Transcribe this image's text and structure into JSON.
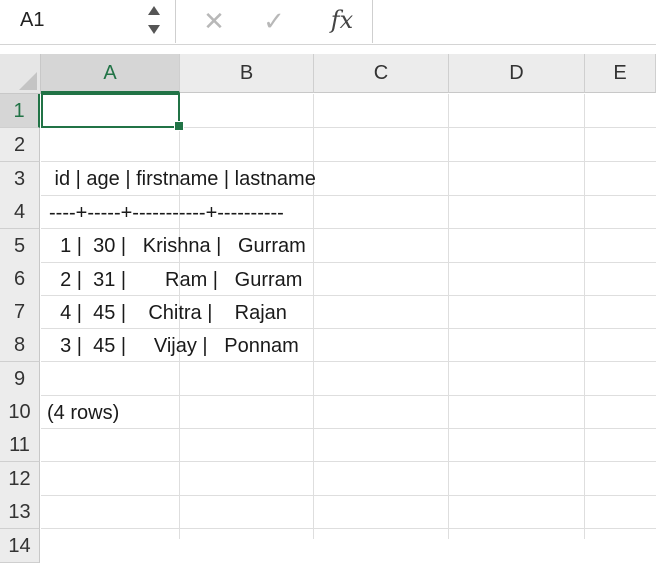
{
  "formula_bar": {
    "name_box": "A1",
    "cancel_icon": "✕",
    "confirm_icon": "✓",
    "fx_label": "fx",
    "formula": ""
  },
  "colors": {
    "accent": "#217346",
    "header_bg": "#ececec",
    "gridline": "#dedede"
  },
  "columns": [
    "A",
    "B",
    "C",
    "D",
    "E"
  ],
  "rows": [
    "1",
    "2",
    "3",
    "4",
    "5",
    "6",
    "7",
    "8",
    "9",
    "10",
    "11",
    "12",
    "13",
    "14"
  ],
  "cells": {
    "A1": "",
    "A2": " id | age | firstname | lastname",
    "A3": "----+-----+-----------+----------",
    "A4": "  1 |  30 |   Krishna |   Gurram",
    "A5": "  2 |  31 |       Ram |   Gurram",
    "A6": "  4 |  45 |    Chitra |    Rajan",
    "A7": "  3 |  45 |     Vijay |   Ponnam",
    "A8": "",
    "A9": "(4 rows)"
  },
  "selected_cell": "A1"
}
